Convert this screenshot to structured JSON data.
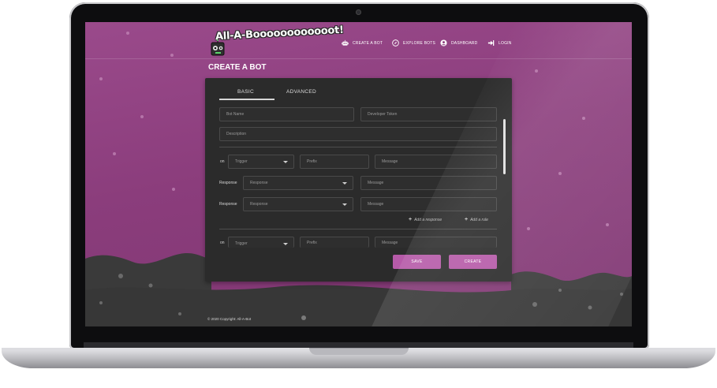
{
  "app": {
    "logo_text": "All-A-Boooooooooooot!"
  },
  "nav": {
    "items": [
      {
        "label": "CREATE A BOT",
        "icon": "robot-icon"
      },
      {
        "label": "EXPLORE BOTS",
        "icon": "compass-icon"
      },
      {
        "label": "DASHBOARD",
        "icon": "user-circle-icon"
      },
      {
        "label": "LOGIN",
        "icon": "login-icon"
      }
    ]
  },
  "page": {
    "title": "CREATE A BOT"
  },
  "form": {
    "tabs": [
      {
        "label": "BASIC",
        "active": true
      },
      {
        "label": "ADVANCED",
        "active": false
      }
    ],
    "bot_name_placeholder": "Bot Name",
    "developer_token_placeholder": "Developer Token",
    "description_placeholder": "Description",
    "rule_1": {
      "on_label": "on",
      "trigger_value": "Trigger",
      "prefix_placeholder": "Prefix",
      "message_placeholder": "Message",
      "responses": [
        {
          "label": "Response",
          "select_value": "Response",
          "message_placeholder": "Message"
        },
        {
          "label": "Response",
          "select_value": "Response",
          "message_placeholder": "Message"
        }
      ],
      "add_response_label": "Add a response",
      "add_rule_label": "Add a rule"
    },
    "rule_2": {
      "on_label": "on",
      "trigger_value": "Trigger",
      "prefix_placeholder": "Prefix",
      "message_placeholder": "Message"
    },
    "save_label": "SAVE",
    "create_label": "CREATE"
  },
  "footer": {
    "copyright": "© 2020 Copyright: All-A-Bot"
  },
  "colors": {
    "background_purple": "#8e3d7e",
    "card": "#2b2b2b",
    "button": "#b65aa8",
    "ground": "#3a3a3a"
  }
}
